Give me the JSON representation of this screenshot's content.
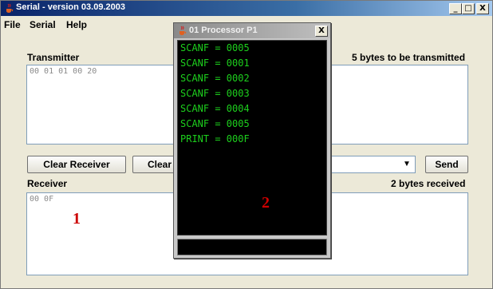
{
  "main_window": {
    "title": "Serial - version 03.09.2003",
    "controls": {
      "minimize": "_",
      "maximize": "□",
      "close": "X"
    }
  },
  "menu": [
    "File",
    "Serial",
    "Help"
  ],
  "transmitter": {
    "label": "Transmitter",
    "status": "5 bytes to be transmitted",
    "content": "00 01 01 00 20"
  },
  "buttons": {
    "clear_receiver": "Clear Receiver",
    "clear_transmitter": "Clear",
    "send": "Send"
  },
  "receiver": {
    "label": "Receiver",
    "status": "2 bytes received",
    "content": "00 0F"
  },
  "annotations": {
    "one": "1",
    "two": "2"
  },
  "processor_window": {
    "title": "01 Processor P1",
    "close": "X",
    "console_lines": [
      "SCANF = 0005",
      "SCANF = 0001",
      "SCANF = 0002",
      "SCANF = 0003",
      "SCANF = 0004",
      "SCANF = 0005",
      "PRINT = 000F"
    ],
    "input_value": ""
  },
  "colors": {
    "title_active": "#0a246a",
    "console_text": "#1dd01d",
    "annotation": "#cc0000"
  },
  "icons": {
    "app": "java-cup-icon",
    "combo": "chevron-down-icon"
  }
}
